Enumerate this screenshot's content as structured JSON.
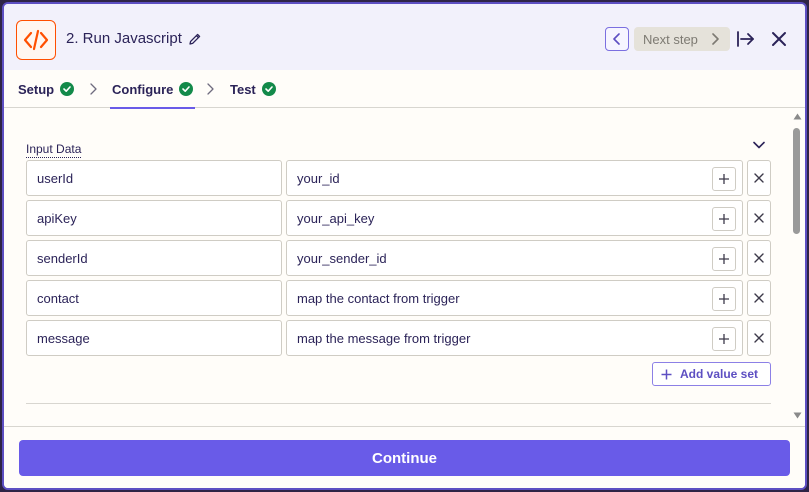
{
  "header": {
    "step_title": "2. Run Javascript",
    "next_step_label": "Next step",
    "icons": {
      "app": "code-brackets-icon",
      "edit": "pencil-icon",
      "prev": "chevron-left-icon",
      "next": "chevron-right-icon",
      "expand": "expand-panel-icon",
      "close": "close-icon"
    }
  },
  "tabs": [
    {
      "label": "Setup",
      "status": "complete"
    },
    {
      "label": "Configure",
      "status": "complete",
      "active": true
    },
    {
      "label": "Test",
      "status": "complete"
    }
  ],
  "input_data": {
    "label": "Input Data",
    "rows": [
      {
        "key": "userId",
        "value": "your_id"
      },
      {
        "key": "apiKey",
        "value": "your_api_key"
      },
      {
        "key": "senderId",
        "value": "your_sender_id"
      },
      {
        "key": "contact",
        "value": "map the contact from trigger"
      },
      {
        "key": "message",
        "value": "map the message from trigger"
      }
    ],
    "add_label": "Add value set"
  },
  "footer": {
    "continue_label": "Continue"
  },
  "colors": {
    "accent": "#695be8",
    "brand_orange": "#ff4f00",
    "success": "#138a4a",
    "header_bg": "#f2f1fb"
  }
}
